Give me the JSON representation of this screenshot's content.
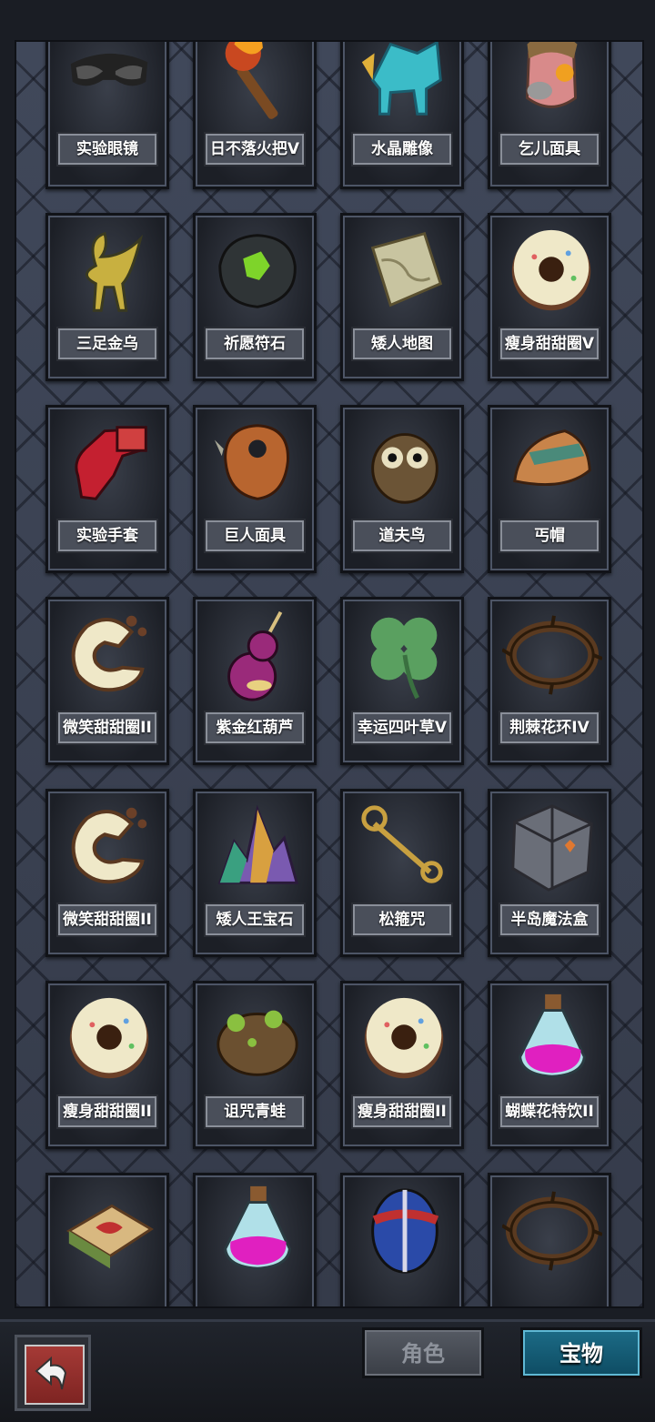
{
  "items": [
    {
      "label": "实验眼镜",
      "icon": "sunglasses-icon"
    },
    {
      "label": "日不落火把V",
      "icon": "torch-icon"
    },
    {
      "label": "水晶雕像",
      "icon": "crystal-statue-icon"
    },
    {
      "label": "乞儿面具",
      "icon": "beggar-mask-icon"
    },
    {
      "label": "三足金乌",
      "icon": "golden-crow-icon"
    },
    {
      "label": "祈愿符石",
      "icon": "wish-rune-stone-icon"
    },
    {
      "label": "矮人地图",
      "icon": "dwarf-map-icon"
    },
    {
      "label": "瘦身甜甜圈V",
      "icon": "donut-icon"
    },
    {
      "label": "实验手套",
      "icon": "glove-icon"
    },
    {
      "label": "巨人面具",
      "icon": "giant-mask-icon"
    },
    {
      "label": "道夫鸟",
      "icon": "owl-icon"
    },
    {
      "label": "丐帽",
      "icon": "beggar-hat-icon"
    },
    {
      "label": "微笑甜甜圈II",
      "icon": "bitten-donut-icon"
    },
    {
      "label": "紫金红葫芦",
      "icon": "gourd-icon"
    },
    {
      "label": "幸运四叶草V",
      "icon": "four-leaf-clover-icon"
    },
    {
      "label": "荆棘花环IV",
      "icon": "thorn-wreath-icon"
    },
    {
      "label": "微笑甜甜圈II",
      "icon": "bitten-donut-icon"
    },
    {
      "label": "矮人王宝石",
      "icon": "gem-crystals-icon"
    },
    {
      "label": "松箍咒",
      "icon": "staff-icon"
    },
    {
      "label": "半岛魔法盒",
      "icon": "magic-box-icon"
    },
    {
      "label": "瘦身甜甜圈II",
      "icon": "donut-icon"
    },
    {
      "label": "诅咒青蛙",
      "icon": "frog-icon"
    },
    {
      "label": "瘦身甜甜圈II",
      "icon": "donut-icon"
    },
    {
      "label": "蝴蝶花特饮II",
      "icon": "potion-icon"
    },
    {
      "label": "",
      "icon": "sandwich-icon"
    },
    {
      "label": "",
      "icon": "potion-icon"
    },
    {
      "label": "",
      "icon": "egg-icon"
    },
    {
      "label": "",
      "icon": "thorn-wreath-icon"
    }
  ],
  "tabs": {
    "character": "角色",
    "treasure": "宝物"
  },
  "colors": {
    "active_tab": "#1c6b86",
    "inactive_tab": "#555a63",
    "back_button": "#a53a36"
  }
}
